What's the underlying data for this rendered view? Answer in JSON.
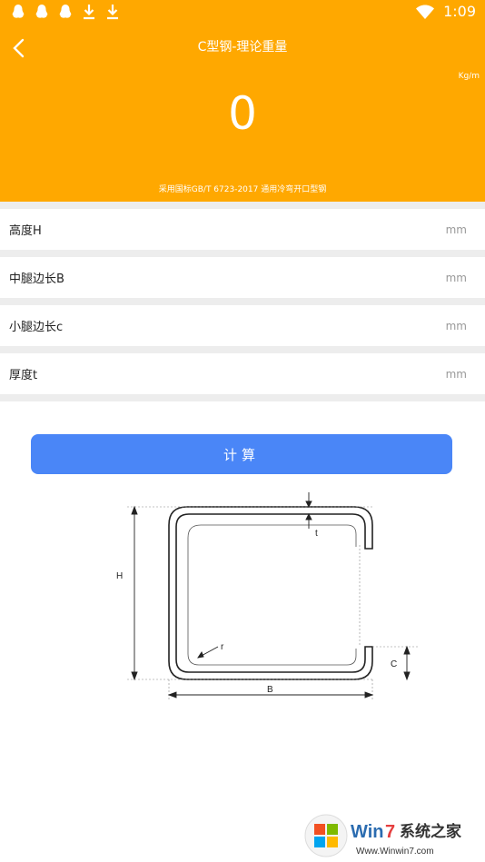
{
  "status_bar": {
    "time": "1:09",
    "left_icons": [
      "penguin-icon",
      "penguin-icon",
      "penguin-icon",
      "download-icon",
      "download-icon"
    ],
    "right_icons": [
      "wifi-icon"
    ]
  },
  "header": {
    "title": "C型钢-理论重量",
    "unit": "Kg/m",
    "result": "0",
    "standard_note": "采用国标GB/T 6723-2017 通用冷弯开口型钢"
  },
  "form": {
    "fields": [
      {
        "label": "高度H",
        "value": "",
        "unit": "mm"
      },
      {
        "label": "中腿边长B",
        "value": "",
        "unit": "mm"
      },
      {
        "label": "小腿边长c",
        "value": "",
        "unit": "mm"
      },
      {
        "label": "厚度t",
        "value": "",
        "unit": "mm"
      }
    ]
  },
  "calculate_button": {
    "label": "计算"
  },
  "diagram": {
    "labels": {
      "H": "H",
      "B": "B",
      "C": "C",
      "t": "t",
      "r": "r"
    }
  },
  "watermark": {
    "brand_win": "Win",
    "brand_7": "7",
    "brand_cn": "系统之家",
    "url": "Www.Winwin7.com"
  },
  "colors": {
    "header_bg": "#FFA800",
    "button_bg": "#4A86F7",
    "separator": "#EDEDED"
  }
}
